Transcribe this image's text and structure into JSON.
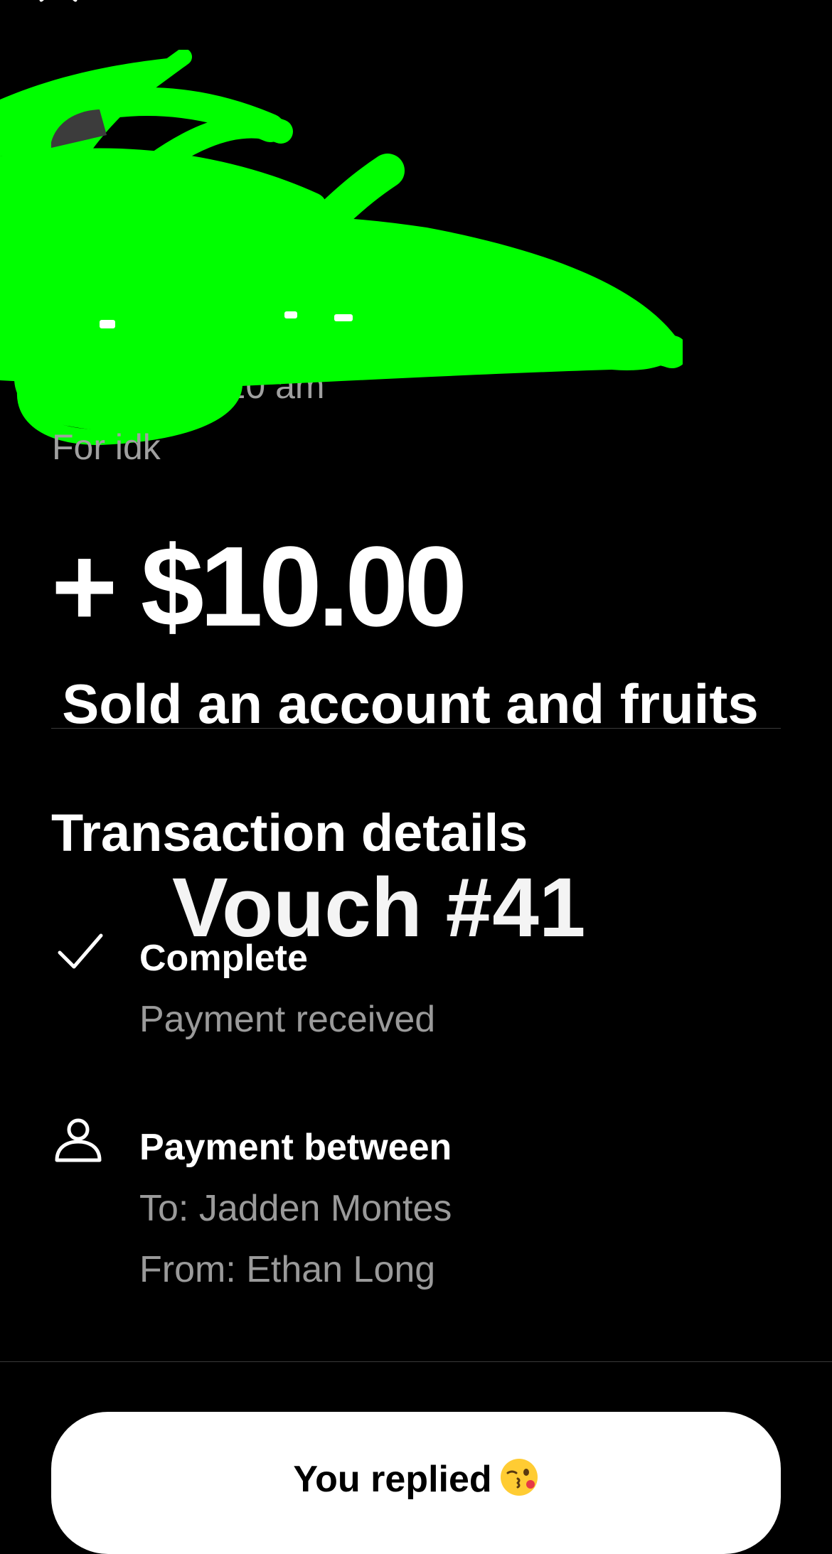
{
  "header": {
    "close_icon": "close-icon"
  },
  "transaction": {
    "date": "Today at 8:20 am",
    "note": "For idk",
    "amount": "+ $10.00"
  },
  "caption": "Sold an account and fruits",
  "section_heading": "Transaction details",
  "overlay_text": "Vouch #41",
  "status": {
    "icon": "checkmark-icon",
    "title": "Complete",
    "subtitle": "Payment received"
  },
  "parties": {
    "icon": "person-icon",
    "title": "Payment between",
    "to": "To: Jadden Montes",
    "from": "From: Ethan Long"
  },
  "reply_button": {
    "label": "You replied",
    "emoji": "winking-kiss-emoji"
  },
  "colors": {
    "background": "#000000",
    "redaction": "#00ff00",
    "muted_text": "#9a9a9a",
    "button": "#ffffff"
  }
}
